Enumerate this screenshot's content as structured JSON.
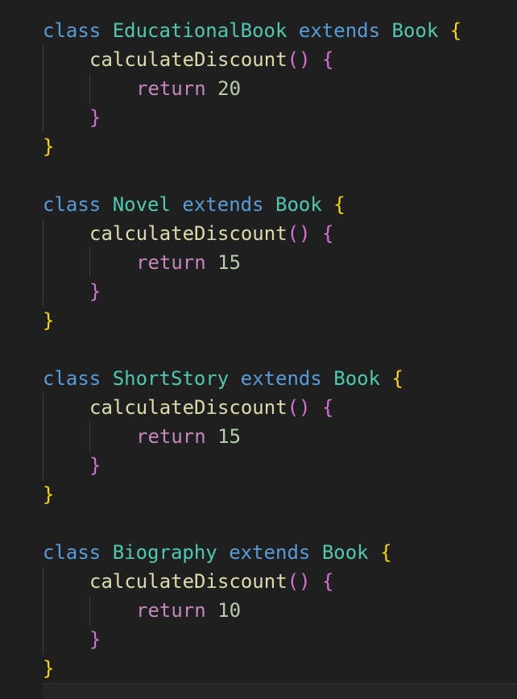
{
  "editor": {
    "language": "javascript",
    "theme_colors": {
      "background": "#1f1f1f",
      "keyword": "#569cd6",
      "class_name": "#4ec9b0",
      "function_name": "#dcdcaa",
      "control_keyword": "#c586c0",
      "number": "#b5cea8",
      "bracket_level_1": "#ffd700",
      "bracket_level_2": "#da70d6"
    },
    "tokens": {
      "class_kw": "class",
      "extends_kw": "extends",
      "return_kw": "return",
      "open_brace": "{",
      "close_brace": "}",
      "parens": "()"
    },
    "blocks": [
      {
        "class_name": "EducationalBook",
        "parent": "Book",
        "method": "calculateDiscount",
        "return_value": "20"
      },
      {
        "class_name": "Novel",
        "parent": "Book",
        "method": "calculateDiscount",
        "return_value": "15"
      },
      {
        "class_name": "ShortStory",
        "parent": "Book",
        "method": "calculateDiscount",
        "return_value": "15"
      },
      {
        "class_name": "Biography",
        "parent": "Book",
        "method": "calculateDiscount",
        "return_value": "10"
      }
    ]
  }
}
